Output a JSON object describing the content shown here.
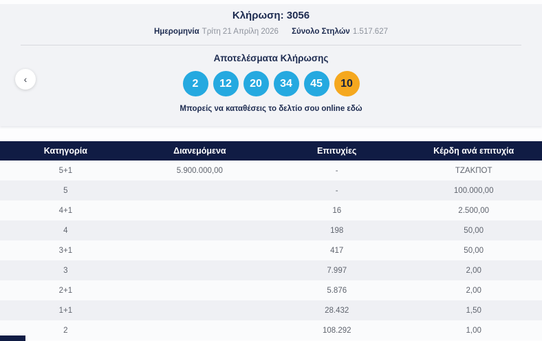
{
  "draw": {
    "title_label": "Κλήρωση:",
    "title_number": "3056",
    "date_label": "Ημερομηνία",
    "date_value": "Τρίτη 21 Απρίλη 2026",
    "columns_label": "Σύνολο Στηλών",
    "columns_value": "1.517.627"
  },
  "results": {
    "heading": "Αποτελέσματα Κλήρωσης",
    "numbers": [
      "2",
      "12",
      "20",
      "34",
      "45"
    ],
    "joker_number": "10",
    "caption": "Μπορείς να καταθέσεις το δελτίο σου online εδώ",
    "prev_arrow_glyph": "‹"
  },
  "table": {
    "headers": [
      "Κατηγορία",
      "Διανεμόμενα",
      "Επιτυχίες",
      "Κέρδη ανά επιτυχία"
    ],
    "rows": [
      {
        "category": "5+1",
        "distributed": "5.900.000,00",
        "winners": "-",
        "prize": "ΤΖΑΚΠΟΤ"
      },
      {
        "category": "5",
        "distributed": "",
        "winners": "-",
        "prize": "100.000,00"
      },
      {
        "category": "4+1",
        "distributed": "",
        "winners": "16",
        "prize": "2.500,00"
      },
      {
        "category": "4",
        "distributed": "",
        "winners": "198",
        "prize": "50,00"
      },
      {
        "category": "3+1",
        "distributed": "",
        "winners": "417",
        "prize": "50,00"
      },
      {
        "category": "3",
        "distributed": "",
        "winners": "7.997",
        "prize": "2,00"
      },
      {
        "category": "2+1",
        "distributed": "",
        "winners": "5.876",
        "prize": "2,00"
      },
      {
        "category": "1+1",
        "distributed": "",
        "winners": "28.432",
        "prize": "1,50"
      },
      {
        "category": "2",
        "distributed": "",
        "winners": "108.292",
        "prize": "1,00"
      }
    ]
  },
  "colors": {
    "ball_blue": "#25a9e0",
    "ball_joker": "#f5a81f",
    "header_navy": "#101c44",
    "title_navy": "#1d2b50"
  }
}
